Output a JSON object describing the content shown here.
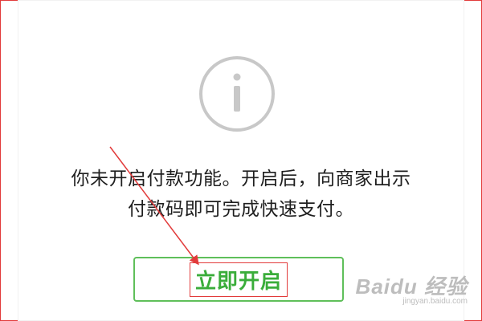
{
  "dialog": {
    "icon": "info-icon",
    "message_line1": "你未开启付款功能。开启后，向商家出示",
    "message_line2": "付款码即可完成快速支付。",
    "enable_button_label": "立即开启"
  },
  "watermark": {
    "logo": "Baidu 经验",
    "url": "jingyan.baidu.com"
  },
  "colors": {
    "accent": "#3aad3a",
    "button_border": "#5fbf5a",
    "annotation": "#e23b3b",
    "icon": "#c8c8c8"
  }
}
